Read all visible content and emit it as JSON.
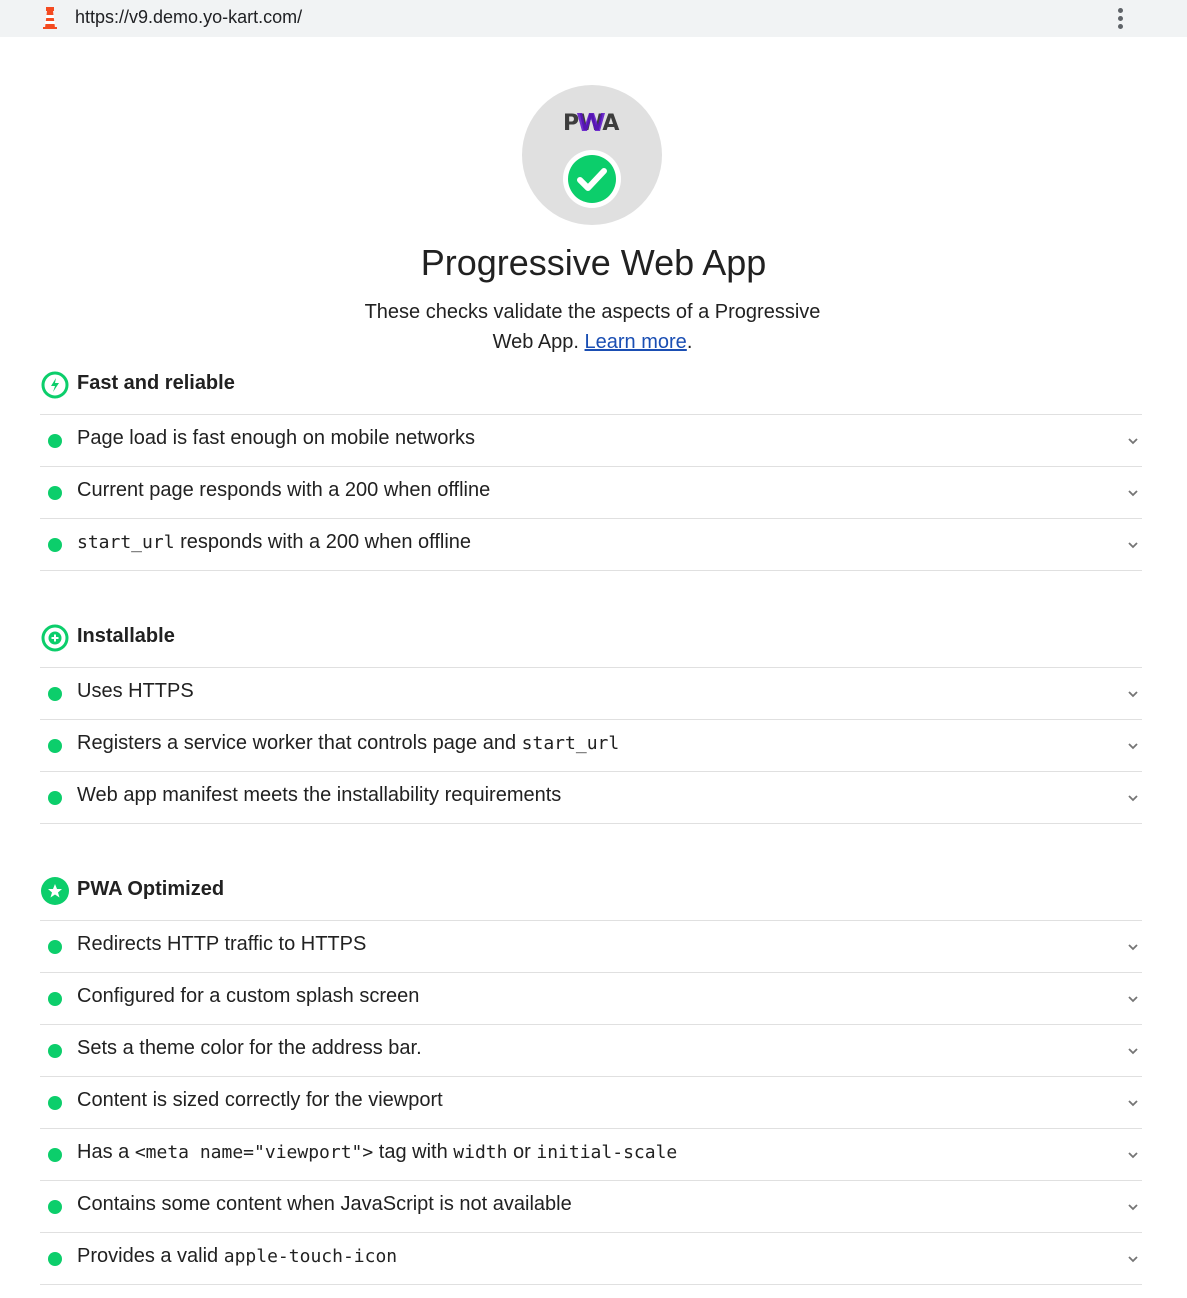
{
  "browser": {
    "url": "https://v9.demo.yo-kart.com/"
  },
  "colors": {
    "pass": "#0cce6b",
    "gauge_bg": "#e0e0e0",
    "link": "#1a4eb3"
  },
  "header": {
    "logo_text": "PWA",
    "title": "Progressive Web App",
    "description_pre": "These checks validate the aspects of a Progressive Web App. ",
    "learn_more": "Learn more",
    "description_post": "."
  },
  "groups": [
    {
      "title": "Fast and reliable",
      "icon": "lightning-bolt-icon",
      "audits": [
        {
          "parts": [
            {
              "t": "Page load is fast enough on mobile networks"
            }
          ]
        },
        {
          "parts": [
            {
              "t": "Current page responds with a 200 when offline"
            }
          ]
        },
        {
          "parts": [
            {
              "c": "start_url"
            },
            {
              "t": " responds with a 200 when offline"
            }
          ]
        }
      ]
    },
    {
      "title": "Installable",
      "icon": "plus-icon",
      "audits": [
        {
          "parts": [
            {
              "t": "Uses HTTPS"
            }
          ]
        },
        {
          "parts": [
            {
              "t": "Registers a service worker that controls page and "
            },
            {
              "c": "start_url"
            }
          ]
        },
        {
          "parts": [
            {
              "t": "Web app manifest meets the installability requirements"
            }
          ]
        }
      ]
    },
    {
      "title": "PWA Optimized",
      "icon": "star-icon",
      "audits": [
        {
          "parts": [
            {
              "t": "Redirects HTTP traffic to HTTPS"
            }
          ]
        },
        {
          "parts": [
            {
              "t": "Configured for a custom splash screen"
            }
          ]
        },
        {
          "parts": [
            {
              "t": "Sets a theme color for the address bar."
            }
          ]
        },
        {
          "parts": [
            {
              "t": "Content is sized correctly for the viewport"
            }
          ]
        },
        {
          "parts": [
            {
              "t": "Has a "
            },
            {
              "c": "<meta name=\"viewport\">"
            },
            {
              "t": " tag with "
            },
            {
              "c": "width"
            },
            {
              "t": " or "
            },
            {
              "c": "initial-scale"
            }
          ]
        },
        {
          "parts": [
            {
              "t": "Contains some content when JavaScript is not available"
            }
          ]
        },
        {
          "parts": [
            {
              "t": "Provides a valid "
            },
            {
              "c": "apple-touch-icon"
            }
          ]
        }
      ]
    }
  ]
}
